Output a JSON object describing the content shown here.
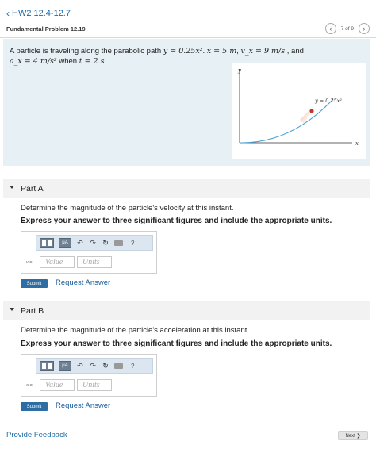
{
  "nav": {
    "back_label": "HW2 12.4-12.7"
  },
  "problem_header": {
    "title": "Fundamental Problem 12.19",
    "position": "7 of 9"
  },
  "problem": {
    "text_parts": [
      "A particle is traveling along the parabolic path ",
      "y = 0.25x²",
      ". ",
      "x = 5  m",
      ", ",
      "v_x = 9  m/s",
      " , and",
      "a_x = 4 m/s²",
      " when ",
      "t = 2 s",
      "."
    ],
    "figure": {
      "y_axis_label": "y",
      "x_axis_label": "x",
      "curve_label": "y = 0.25x²"
    }
  },
  "parts": [
    {
      "label": "Part A",
      "question": "Determine the magnitude of the particle's velocity at this instant.",
      "instruction": "Express your answer to three significant figures and include the appropriate units.",
      "var_label": "v =",
      "value_placeholder": "Value",
      "units_placeholder": "Units",
      "submit_label": "Submit",
      "request_label": "Request Answer"
    },
    {
      "label": "Part B",
      "question": "Determine the magnitude of the particle's acceleration at this instant.",
      "instruction": "Express your answer to three significant figures and include the appropriate units.",
      "var_label": "a =",
      "value_placeholder": "Value",
      "units_placeholder": "Units",
      "submit_label": "Submit",
      "request_label": "Request Answer"
    }
  ],
  "toolbar": {
    "mu_label": "μA",
    "help_label": "?"
  },
  "footer": {
    "feedback_label": "Provide Feedback",
    "next_label": "Next ❯"
  },
  "colors": {
    "accent": "#1a6aa8",
    "panel_bg": "#e7f0f5",
    "submit_bg": "#2e6da4",
    "curve": "#4aa0d0",
    "point": "#c0392b"
  }
}
